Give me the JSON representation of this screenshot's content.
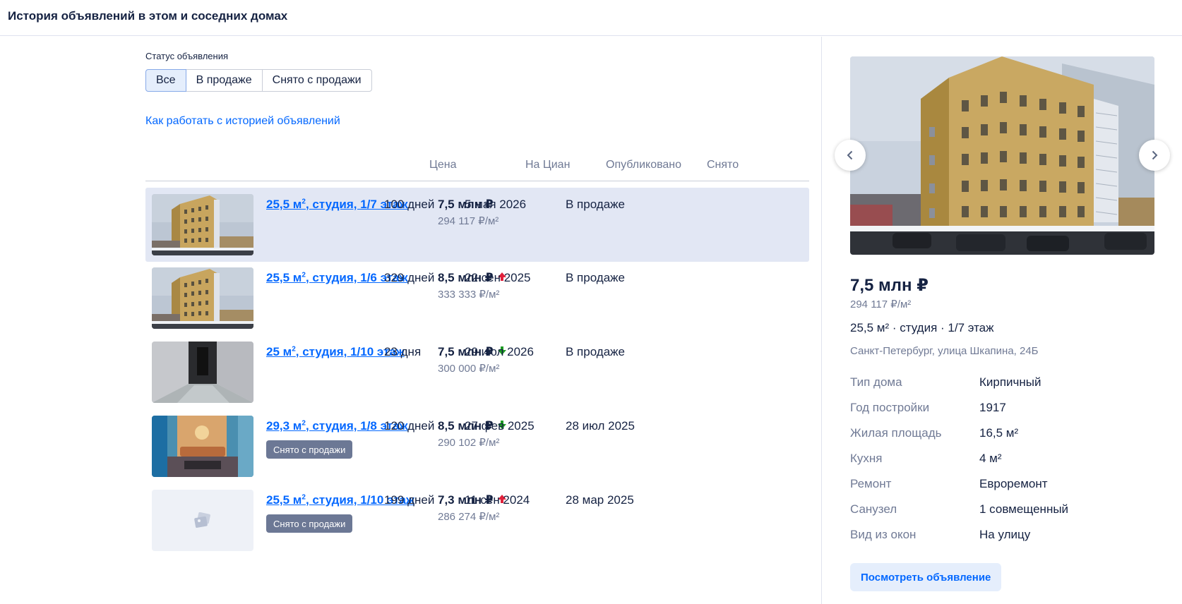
{
  "header": {
    "title": "История объявлений в этом и соседних домах"
  },
  "filters": {
    "label": "Статус объявления",
    "options": [
      "Все",
      "В продаже",
      "Снято с продажи"
    ],
    "active": "Все"
  },
  "help_link": "Как работать с историей объявлений",
  "table": {
    "columns": {
      "price": "Цена",
      "on_cian": "На Циан",
      "published": "Опубликовано",
      "removed": "Снято"
    },
    "rows": [
      {
        "area": "25,5 м",
        "sup": "2",
        "rest": ", студия, 1/7 этаж",
        "badge": "",
        "price": "7,5 млн ₽",
        "trend": "none",
        "ppm": "294 117 ₽/м²",
        "on_cian": "100 дней",
        "published": "5 мая 2026",
        "removed": "В продаже",
        "thumb": "building"
      },
      {
        "area": "25,5 м",
        "sup": "2",
        "rest": ", студия, 1/6 этаж",
        "badge": "",
        "price": "8,5 млн ₽",
        "trend": "up",
        "ppm": "333 333 ₽/м²",
        "on_cian": "329 дней",
        "published": "22 сен 2025",
        "removed": "В продаже",
        "thumb": "building"
      },
      {
        "area": "25 м",
        "sup": "2",
        "rest": ", студия, 1/10 этаж",
        "badge": "",
        "price": "7,5 млн ₽",
        "trend": "down",
        "ppm": "300 000 ₽/м²",
        "on_cian": "23 дня",
        "published": "29 июл 2026",
        "removed": "В продаже",
        "thumb": "hallway"
      },
      {
        "area": "29,3 м",
        "sup": "2",
        "rest": ", студия, 1/8 этаж",
        "badge": "Снято с продажи",
        "price": "8,5 млн ₽",
        "trend": "down",
        "ppm": "290 102 ₽/м²",
        "on_cian": "120 дней",
        "published": "27 фев 2025",
        "removed": "28 июл 2025",
        "thumb": "room"
      },
      {
        "area": "25,5 м",
        "sup": "2",
        "rest": ", студия, 1/10 этаж",
        "badge": "Снято с продажи",
        "price": "7,3 млн ₽",
        "trend": "up",
        "ppm": "286 274 ₽/м²",
        "on_cian": "199 дней",
        "published": "11 сен 2024",
        "removed": "28 мар 2025",
        "thumb": "placeholder"
      }
    ]
  },
  "panel": {
    "price": "7,5 млн ₽",
    "ppm": "294 117 ₽/м²",
    "desc": "25,5 м² · студия · 1/7 этаж",
    "address": "Санкт-Петербург, улица Шкапина, 24Б",
    "props": [
      {
        "label": "Тип дома",
        "value": "Кирпичный"
      },
      {
        "label": "Год постройки",
        "value": "1917"
      },
      {
        "label": "Жилая площадь",
        "value": "16,5 м²"
      },
      {
        "label": "Кухня",
        "value": "4 м²"
      },
      {
        "label": "Ремонт",
        "value": "Евроремонт"
      },
      {
        "label": "Санузел",
        "value": "1 совмещенный"
      },
      {
        "label": "Вид из окон",
        "value": "На улицу"
      }
    ],
    "view_button": "Посмотреть объявление"
  },
  "colors": {
    "accent": "#0468ff",
    "trend_up": "#e0213b",
    "trend_down": "#1e9b24",
    "badge": "#6c7895",
    "selected_row": "#e2e7f4"
  },
  "icons": {
    "gallery_prev": "chevron-left-icon",
    "gallery_next": "chevron-right-icon",
    "no_photo": "no-photo-icon",
    "trend_up": "arrow-up-icon",
    "trend_down": "arrow-down-icon"
  }
}
